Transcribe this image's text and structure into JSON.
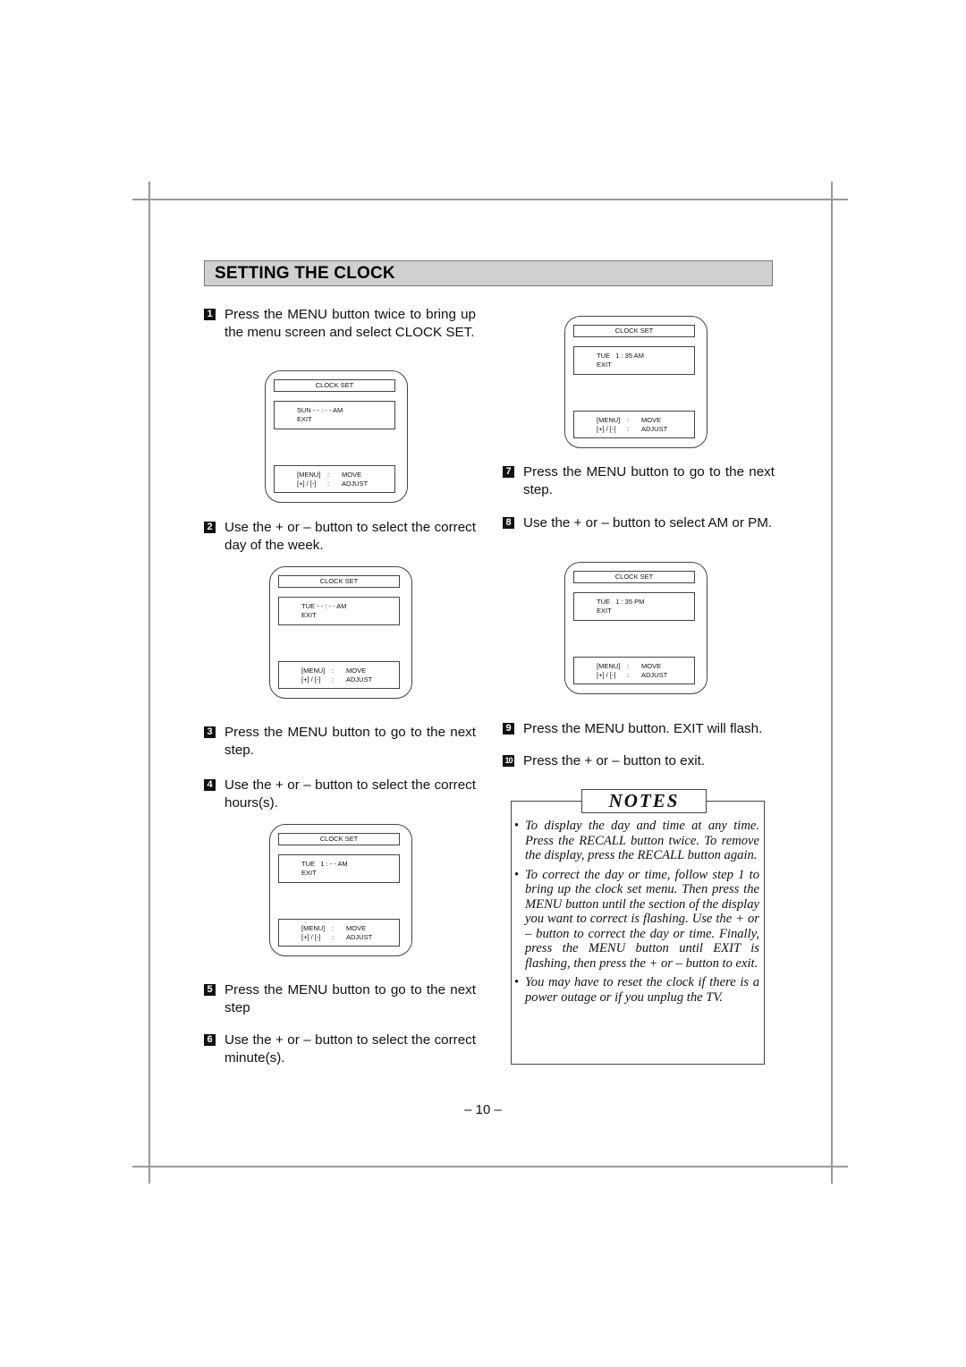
{
  "title": "SETTING THE CLOCK",
  "steps": [
    {
      "num": "1",
      "text": "Press the MENU button twice to bring up the menu screen and select CLOCK SET."
    },
    {
      "num": "2",
      "text": "Use the + or – button to select the correct day of the week."
    },
    {
      "num": "3",
      "text": "Press the MENU button to go to the next step."
    },
    {
      "num": "4",
      "text": "Use the + or – button to select the correct hours(s)."
    },
    {
      "num": "5",
      "text": "Press the MENU button to go to the next step"
    },
    {
      "num": "6",
      "text": "Use the + or – button to select the correct minute(s)."
    },
    {
      "num": "7",
      "text": "Press the MENU button to go to the next step."
    },
    {
      "num": "8",
      "text": "Use the + or – button to select AM or PM."
    },
    {
      "num": "9",
      "text": "Press the MENU button. EXIT will flash."
    },
    {
      "num": "10",
      "text": "Press the + or – button to exit."
    }
  ],
  "screens": [
    {
      "header": "CLOCK SET",
      "line1": "SUN - - : - - AM",
      "line2": "EXIT",
      "key1": "[MENU]",
      "sep": ":",
      "action1": "MOVE",
      "key2": "[+] / [-]",
      "action2": "ADJUST"
    },
    {
      "header": "CLOCK SET",
      "line1": "TUE - - : - - AM",
      "line2": "EXIT",
      "key1": "[MENU]",
      "sep": ":",
      "action1": "MOVE",
      "key2": "[+] / [-]",
      "action2": "ADJUST"
    },
    {
      "header": "CLOCK SET",
      "line1": "TUE   1 : - - AM",
      "line2": "EXIT",
      "key1": "[MENU]",
      "sep": ":",
      "action1": "MOVE",
      "key2": "[+] / [-]",
      "action2": "ADJUST"
    },
    {
      "header": "CLOCK SET",
      "line1": "TUE   1 : 35 AM",
      "line2": "EXIT",
      "key1": "[MENU]",
      "sep": ":",
      "action1": "MOVE",
      "key2": "[+] / [-]",
      "action2": "ADJUST"
    },
    {
      "header": "CLOCK SET",
      "line1": "TUE   1 : 35 PM",
      "line2": "EXIT",
      "key1": "[MENU]",
      "sep": ":",
      "action1": "MOVE",
      "key2": "[+] / [-]",
      "action2": "ADJUST"
    }
  ],
  "notes": {
    "title": "NOTES",
    "bullet": "•",
    "items": [
      "To display the day and time at any time. Press the RECALL button twice. To remove the display, press the RECALL button again.",
      "To correct the day or time, follow step 1 to bring up the clock set menu. Then press the MENU button until the section of the display you want to correct is flashing. Use the + or – button to correct the day or time. Finally, press the MENU button until EXIT is flashing, then press the + or – button to exit.",
      "You may have to reset the clock if there is a power outage or if you unplug the TV."
    ]
  },
  "page_number": "– 10 –"
}
